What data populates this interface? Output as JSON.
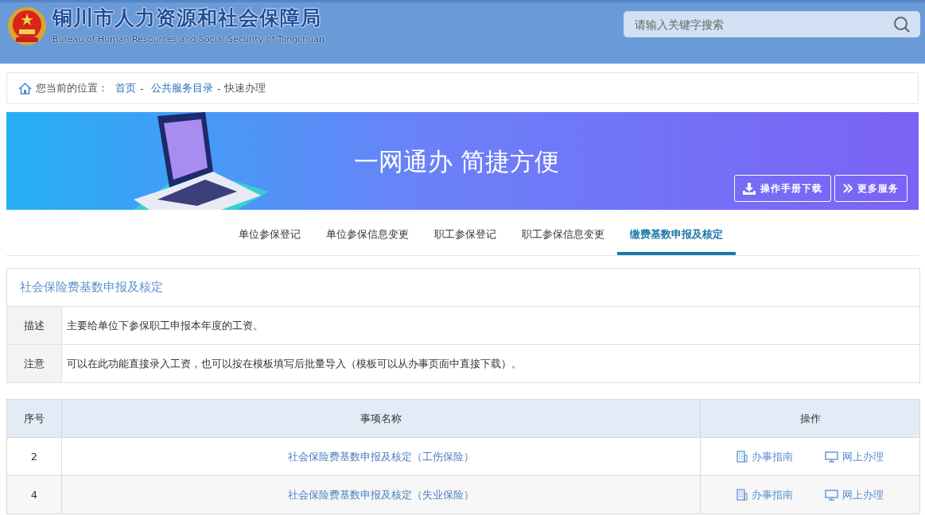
{
  "header": {
    "title": "铜川市人力资源和社会保障局",
    "subtitle": "Bureau of Human Resources and Social Security of Tongchuan",
    "search": {
      "placeholder": "请输入关键字搜索"
    }
  },
  "breadcrumb": {
    "label": "您当前的位置：",
    "items": [
      {
        "text": "首页",
        "kind": "link"
      },
      {
        "text": "-",
        "kind": "sep"
      },
      {
        "text": "公共服务目录",
        "kind": "link"
      },
      {
        "text": "-",
        "kind": "sep"
      },
      {
        "text": "快速办理",
        "kind": "current"
      }
    ]
  },
  "banner": {
    "slogan": "一网通办 简捷方便",
    "buttons": [
      {
        "label": "操作手册下载",
        "kind": "download"
      },
      {
        "label": "更多服务",
        "kind": "more"
      }
    ]
  },
  "tabs": [
    {
      "label": "单位参保登记",
      "selected": false
    },
    {
      "label": "单位参保信息变更",
      "selected": false
    },
    {
      "label": "职工参保登记",
      "selected": false
    },
    {
      "label": "职工参保信息变更",
      "selected": false
    },
    {
      "label": "缴费基数申报及核定",
      "selected": true
    }
  ],
  "info": {
    "title": "社会保险费基数申报及核定",
    "rows": [
      {
        "label": "描述",
        "text": "主要给单位下参保职工申报本年度的工资。"
      },
      {
        "label": "注意",
        "text": "可以在此功能直接录入工资，也可以按在模板填写后批量导入（模板可以从办事页面中直接下载）。"
      }
    ]
  },
  "table": {
    "columns": [
      "序号",
      "事项名称",
      "操作"
    ],
    "rows": [
      {
        "no": "2",
        "name": "社会保险费基数申报及核定（工伤保险）",
        "guide": "办事指南",
        "online": "网上办理"
      },
      {
        "no": "4",
        "name": "社会保险费基数申报及核定（失业保险）",
        "guide": "办事指南",
        "online": "网上办理"
      }
    ]
  }
}
